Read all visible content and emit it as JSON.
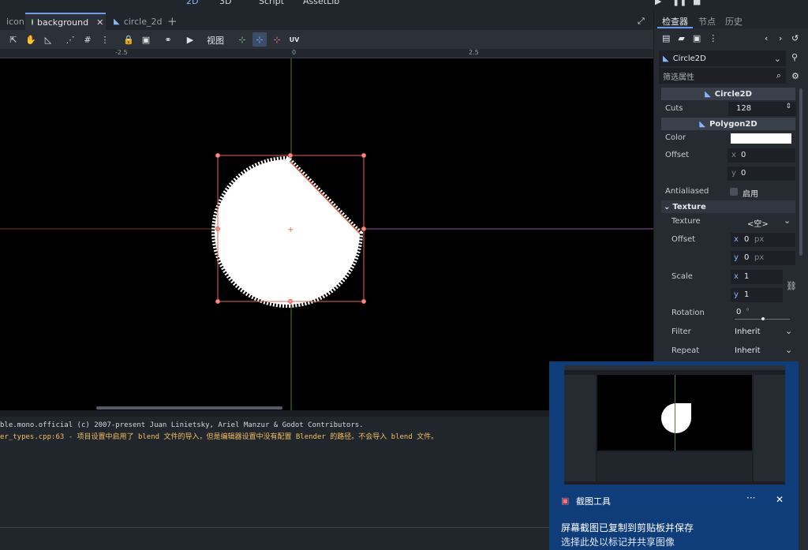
{
  "workspace": {
    "b2d": "2D",
    "b3d": "3D",
    "script": "Script",
    "assetlib": "AssetLib"
  },
  "tabs": [
    {
      "label": "icon"
    },
    {
      "label": "background"
    },
    {
      "label": "circle_2d"
    }
  ],
  "toolbar": {
    "view_label": "视图",
    "uv_label": "UV"
  },
  "ruler": {
    "neg": "-2.5",
    "zero": "0",
    "pos": "2.5"
  },
  "output": {
    "line1": "ble.mono.official (c) 2007-present Juan Linietsky, Ariel Manzur & Godot Contributors.",
    "line2": "er_types.cpp:63 - 项目设置中启用了 blend 文件的导入，但是编辑器设置中没有配置 Blender 的路径。不会导入 blend 文件。"
  },
  "inspector": {
    "tab_inspector": "检查器",
    "tab_node": "节点",
    "tab_history": "历史",
    "node_name": "Circle2D",
    "filter_placeholder": "筛选属性",
    "section_circle": "Circle2D",
    "cuts_label": "Cuts",
    "cuts_value": "128",
    "section_polygon": "Polygon2D",
    "color_label": "Color",
    "offset_label": "Offset",
    "offset_x": "0",
    "offset_y": "0",
    "antialiased_label": "Antialiased",
    "antialiased_value": "启用",
    "texture_section": "Texture",
    "texture_label": "Texture",
    "texture_value": "<空>",
    "toffset_label": "Offset",
    "toffset_x": "0",
    "toffset_y": "0",
    "unit_px": "px",
    "scale_label": "Scale",
    "scale_x": "1",
    "scale_y": "1",
    "rotation_label": "Rotation",
    "rotation_value": "0",
    "rotation_unit": "°",
    "filter_label": "Filter",
    "filter_value": "Inherit",
    "repeat_label": "Repeat",
    "repeat_value": "Inherit",
    "axis_x": "x",
    "axis_y": "y"
  },
  "toast": {
    "app_name": "截图工具",
    "title": "屏幕截图已复制到剪贴板并保存",
    "subtitle": "选择此处以标记并共享图像"
  },
  "colors": {
    "accent": "#6b9cf0",
    "toast_bg": "#0f3d7a",
    "selection": "#e8664e"
  }
}
